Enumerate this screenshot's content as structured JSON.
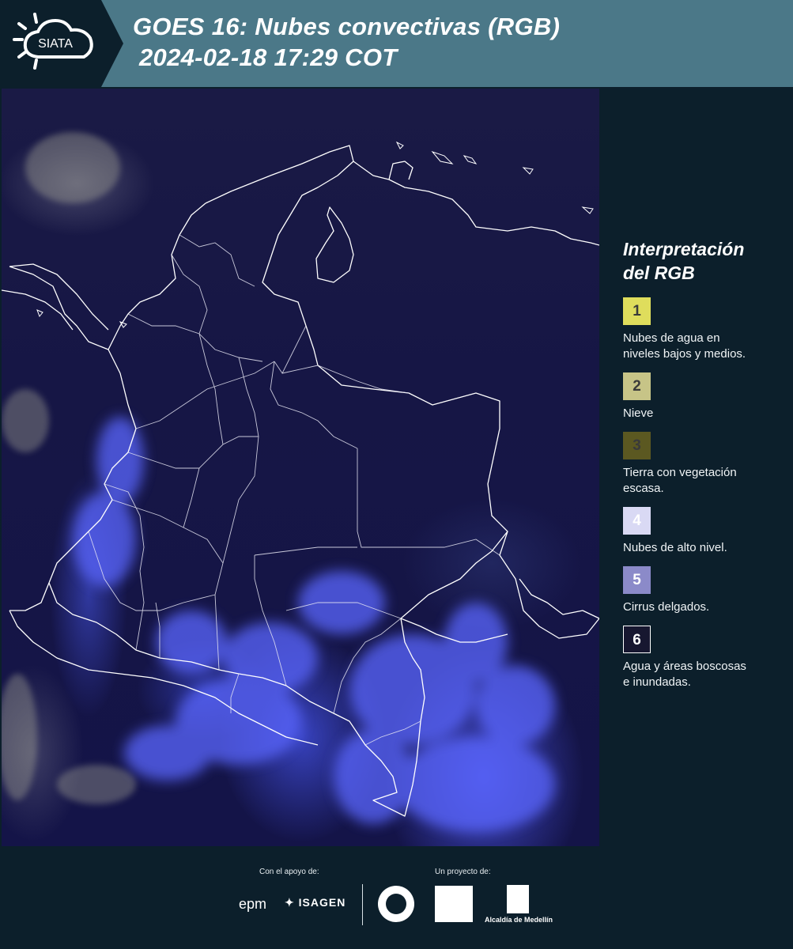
{
  "header": {
    "logo_text": "SIATA",
    "title_line1": "GOES 16: Nubes convectivas (RGB)",
    "title_line2": "2024-02-18 17:29 COT",
    "background_color": "#4b7888"
  },
  "legend": {
    "title_line1": "Interpretación",
    "title_line2": "del RGB",
    "items": [
      {
        "number": "1",
        "label_lines": [
          "Nubes de agua en",
          "niveles bajos y medios."
        ],
        "color": "#dfdd5c"
      },
      {
        "number": "2",
        "label_lines": [
          "Nieve"
        ],
        "color": "#c7c487"
      },
      {
        "number": "3",
        "label_lines": [
          "Tierra con vegetación",
          "escasa."
        ],
        "color": "#5b5821"
      },
      {
        "number": "4",
        "label_lines": [
          "Nubes de alto nivel."
        ],
        "color": "#d9d9f4"
      },
      {
        "number": "5",
        "label_lines": [
          "Cirrus delgados."
        ],
        "color": "#8b8ac9"
      },
      {
        "number": "6",
        "label_lines": [
          "Agua y áreas boscosas",
          "e inundadas."
        ],
        "color": "#171730"
      }
    ]
  },
  "footer": {
    "support_caption": "Con el apoyo de:",
    "project_caption": "Un proyecto de:",
    "epm": "epm",
    "isagen": "ISAGEN",
    "alcaldia": "Alcaldía de Medellín"
  },
  "icons": [
    "siata-sun-cloud-icon",
    "isagen-icon",
    "medellin-seal-icon",
    "area-metropolitana-icon",
    "alcaldia-emblem-icon"
  ]
}
